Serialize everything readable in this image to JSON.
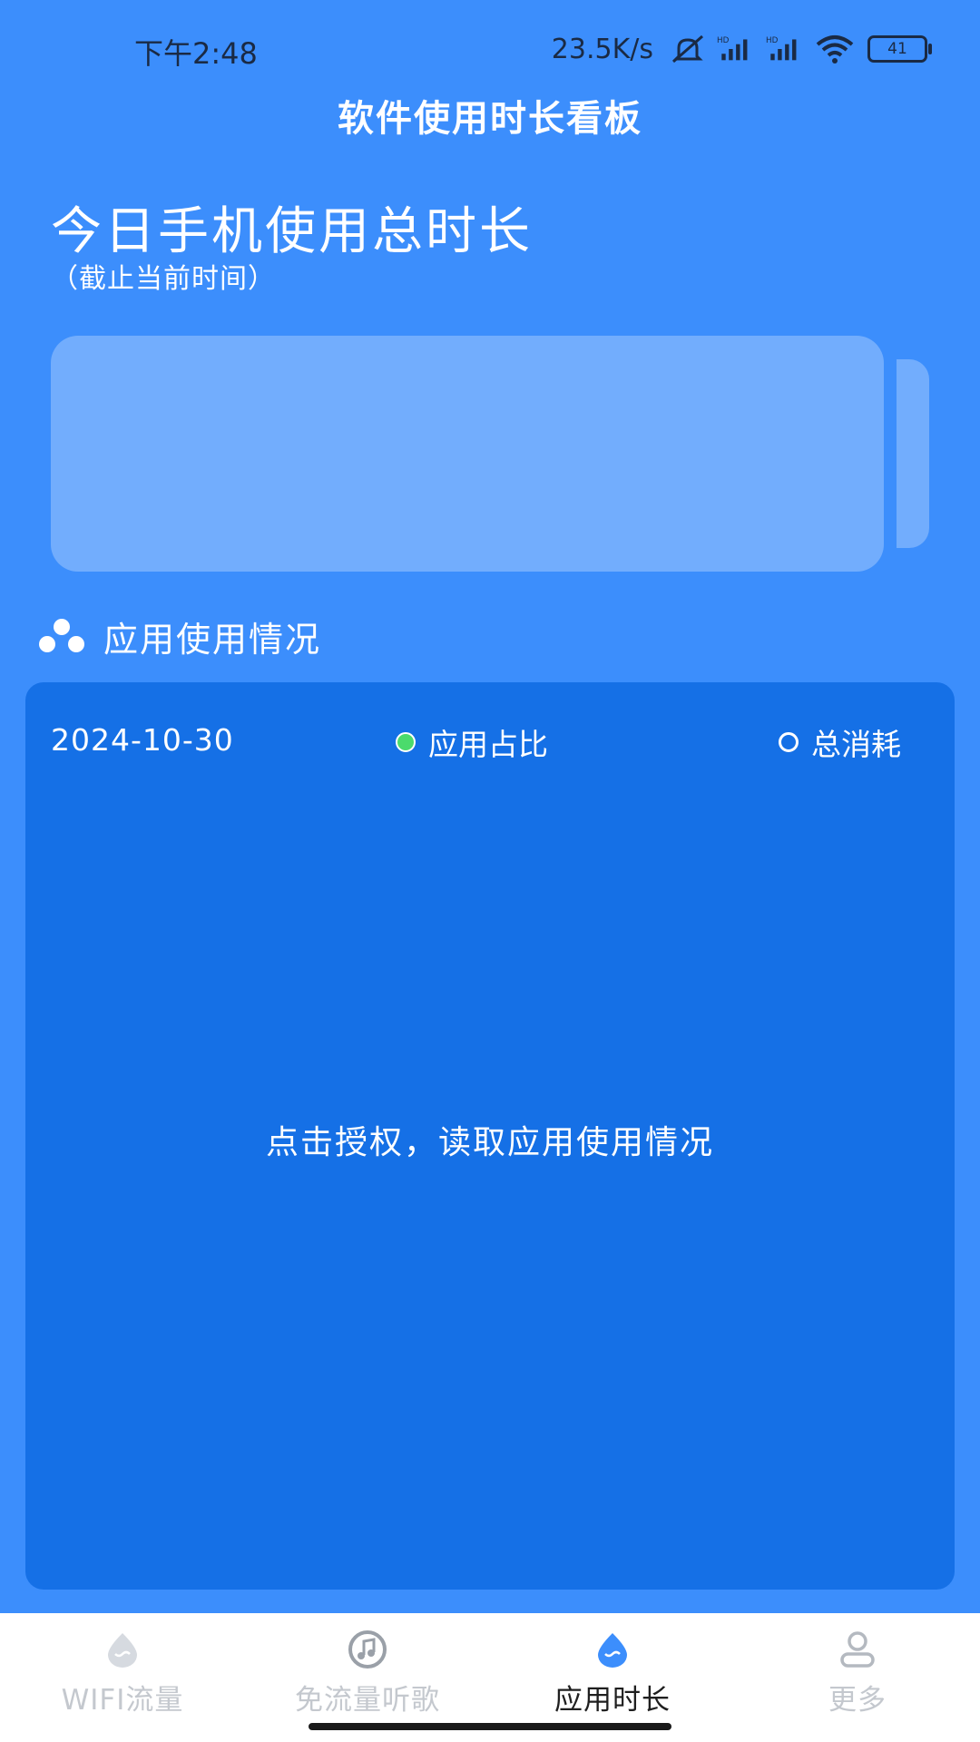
{
  "status_bar": {
    "time": "下午2:48",
    "net_speed": "23.5K/s",
    "battery_level": "41",
    "icons": [
      "mute-icon",
      "signal-hd-icon",
      "signal-hd-icon",
      "wifi-icon",
      "battery-icon"
    ]
  },
  "header": {
    "title": "软件使用时长看板"
  },
  "today": {
    "title": "今日手机使用总时长",
    "subtitle": "（截止当前时间）"
  },
  "usage_section": {
    "icon": "apps-cluster-icon",
    "title": "应用使用情况",
    "date": "2024-10-30",
    "legend": [
      {
        "label": "应用占比",
        "style": "filled",
        "color": "#4BDB6C"
      },
      {
        "label": "总消耗",
        "style": "hollow",
        "color": "#FFFFFF"
      }
    ],
    "auth_prompt": "点击授权，读取应用使用情况"
  },
  "bottom_nav": {
    "items": [
      {
        "label": "WIFI流量",
        "icon": "drop-icon",
        "active": false
      },
      {
        "label": "免流量听歌",
        "icon": "music-note-icon",
        "active": false
      },
      {
        "label": "应用时长",
        "icon": "drop-icon",
        "active": true
      },
      {
        "label": "更多",
        "icon": "user-icon",
        "active": false
      }
    ]
  },
  "colors": {
    "background": "#3C8EFC",
    "card": "#1570E6",
    "active_icon": "#3C8EFC",
    "inactive": "#C4C8CE"
  }
}
